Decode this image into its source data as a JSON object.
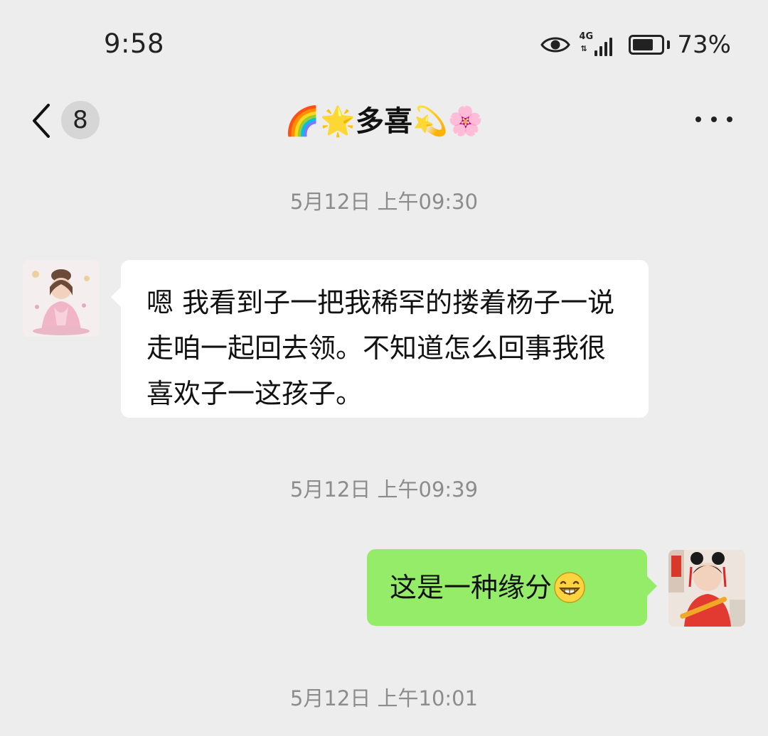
{
  "status_bar": {
    "time": "9:58",
    "network_label": "4G",
    "battery_percent": "73%",
    "battery_level": 0.73,
    "icons": [
      "eye-icon",
      "signal-icon",
      "battery-icon"
    ]
  },
  "header": {
    "back_icon": "chevron-left-icon",
    "unread_count": "8",
    "title": "🌈🌟多喜💫🌸",
    "more_icon": "more-dots-icon"
  },
  "messages": [
    {
      "type": "timestamp",
      "text": "5月12日 上午09:30"
    },
    {
      "type": "incoming",
      "avatar": "avatar-illustrated-lady",
      "text": "嗯  我看到子一把我稀罕的搂着杨子一说走咱一起回去领。不知道怎么回事我很喜欢子一这孩子。"
    },
    {
      "type": "timestamp",
      "text": "5月12日 上午09:39"
    },
    {
      "type": "outgoing",
      "avatar": "avatar-girl-photo",
      "text": "这是一种缘分",
      "emoji": "grin-emoji"
    },
    {
      "type": "timestamp",
      "text": "5月12日 上午10:01"
    }
  ],
  "colors": {
    "background": "#ededed",
    "incoming_bubble": "#ffffff",
    "outgoing_bubble": "#95ec69",
    "timestamp_text": "#8c8c8c",
    "badge_background": "#d6d6d6"
  }
}
